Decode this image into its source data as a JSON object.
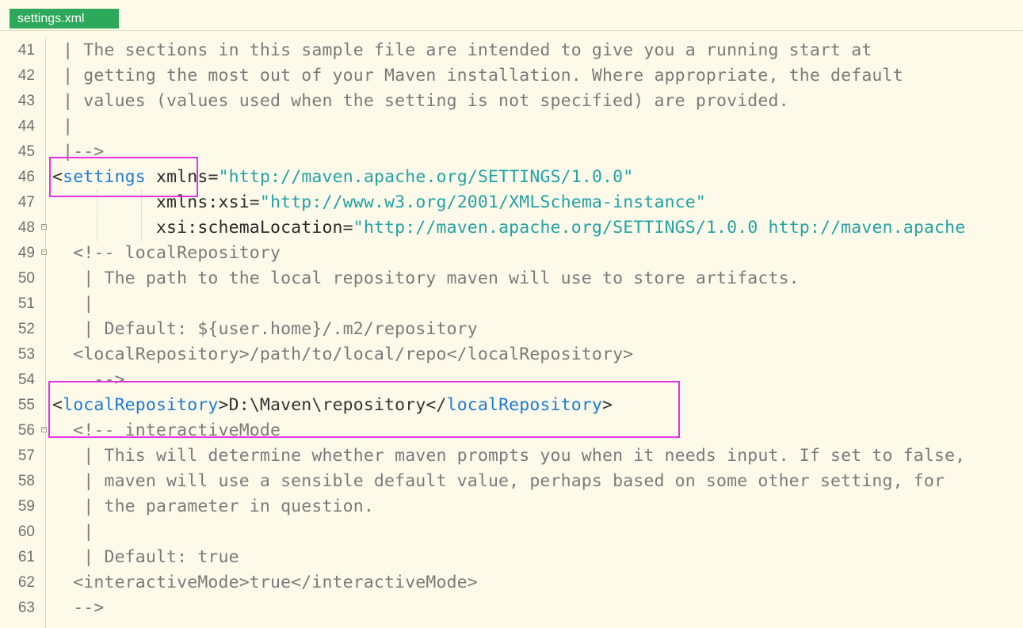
{
  "tab": {
    "label": "settings.xml"
  },
  "lines": [
    {
      "num": "41",
      "text": " | The sections in this sample file are intended to give you a running start at"
    },
    {
      "num": "42",
      "text": " | getting the most out of your Maven installation. Where appropriate, the default"
    },
    {
      "num": "43",
      "text": " | values (values used when the setting is not specified) are provided."
    },
    {
      "num": "44",
      "text": " |"
    },
    {
      "num": "45",
      "text": " |-->"
    },
    {
      "num": "46",
      "parts": [
        [
          "<",
          "punct"
        ],
        [
          "settings",
          "tag"
        ],
        [
          " xmlns",
          "attr"
        ],
        [
          "=",
          "punct"
        ],
        [
          "\"http://maven.apache.org/SETTINGS/1.0.0\"",
          "str"
        ]
      ]
    },
    {
      "num": "47",
      "parts": [
        [
          "          xmlns:xsi",
          "attr"
        ],
        [
          "=",
          "punct"
        ],
        [
          "\"http://www.w3.org/2001/XMLSchema-instance\"",
          "str"
        ]
      ]
    },
    {
      "num": "48",
      "fold": true,
      "parts": [
        [
          "          xsi:schemaLocation",
          "attr"
        ],
        [
          "=",
          "punct"
        ],
        [
          "\"http://maven.apache.org/SETTINGS/1.0.0 http://maven.apache",
          "str"
        ]
      ]
    },
    {
      "num": "49",
      "fold": true,
      "text": "  <!-- localRepository"
    },
    {
      "num": "50",
      "text": "   | The path to the local repository maven will use to store artifacts."
    },
    {
      "num": "51",
      "text": "   |"
    },
    {
      "num": "52",
      "text": "   | Default: ${user.home}/.m2/repository"
    },
    {
      "num": "53",
      "text": "  <localRepository>/path/to/local/repo</localRepository>"
    },
    {
      "num": "54",
      "text": "    -->"
    },
    {
      "num": "55",
      "parts": [
        [
          "<",
          "punct"
        ],
        [
          "localRepository",
          "tag"
        ],
        [
          ">D:\\Maven\\repository</",
          "plain"
        ],
        [
          "localRepository",
          "tag"
        ],
        [
          ">",
          "punct"
        ]
      ]
    },
    {
      "num": "56",
      "fold": true,
      "text": "  <!-- interactiveMode"
    },
    {
      "num": "57",
      "text": "   | This will determine whether maven prompts you when it needs input. If set to false,"
    },
    {
      "num": "58",
      "text": "   | maven will use a sensible default value, perhaps based on some other setting, for"
    },
    {
      "num": "59",
      "text": "   | the parameter in question."
    },
    {
      "num": "60",
      "text": "   |"
    },
    {
      "num": "61",
      "text": "   | Default: true"
    },
    {
      "num": "62",
      "text": "  <interactiveMode>true</interactiveMode>"
    },
    {
      "num": "63",
      "text": "  -->"
    }
  ]
}
